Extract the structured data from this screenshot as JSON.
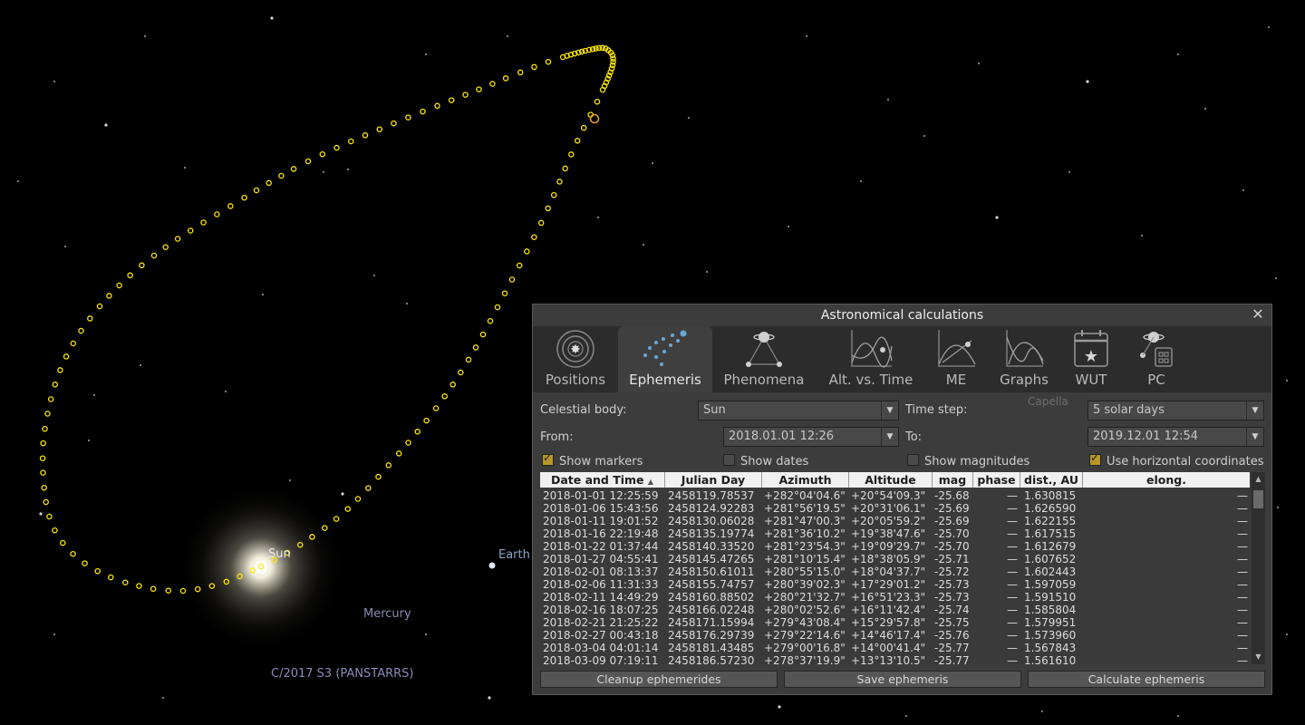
{
  "sky_labels": {
    "sun": "Sun",
    "earth": "Earth",
    "mercury": "Mercury",
    "comet": "C/2017 S3 (PANSTARRS)"
  },
  "colors": {
    "trajectory": "#ffe800",
    "dialog_bg": "#3c3c3c",
    "accent_check": "#b8962a"
  },
  "dialog": {
    "title": "Astronomical calculations",
    "close_icon": "close-icon",
    "tabs": [
      {
        "label": "Positions",
        "icon": "positions-icon"
      },
      {
        "label": "Ephemeris",
        "icon": "ephemeris-icon",
        "active": true
      },
      {
        "label": "Phenomena",
        "icon": "phenomena-icon"
      },
      {
        "label": "Alt. vs. Time",
        "icon": "alt-vs-time-icon"
      },
      {
        "label": "ME",
        "icon": "monthly-elevation-icon"
      },
      {
        "label": "Graphs",
        "icon": "graphs-icon"
      },
      {
        "label": "WUT",
        "icon": "calendar-star-icon"
      },
      {
        "label": "PC",
        "icon": "planetary-calculator-icon"
      }
    ],
    "form": {
      "celestial_body_label": "Celestial body:",
      "celestial_body_value": "Sun",
      "time_step_label": "Time step:",
      "time_step_value": "5 solar days",
      "from_label": "From:",
      "from_value": "2018.01.01 12:26",
      "to_label": "To:",
      "to_value": "2019.12.01 12:54",
      "bg_star_label": "Capella"
    },
    "checks": {
      "show_markers": {
        "label": "Show markers",
        "checked": true
      },
      "show_dates": {
        "label": "Show dates",
        "checked": false
      },
      "show_magnitudes": {
        "label": "Show magnitudes",
        "checked": false
      },
      "use_horizontal": {
        "label": "Use horizontal coordinates",
        "checked": true
      }
    },
    "table": {
      "columns": [
        "Date and Time",
        "Julian Day",
        "Azimuth",
        "Altitude",
        "mag",
        "phase",
        "dist., AU",
        "elong."
      ],
      "sort_indicator": "▲",
      "rows": [
        [
          "2018-01-01 12:25:59",
          "2458119.78537",
          "+282°04'04.6\"",
          "+20°54'09.3\"",
          "-25.68",
          "—",
          "1.630815",
          "—"
        ],
        [
          "2018-01-06 15:43:56",
          "2458124.92283",
          "+281°56'19.5\"",
          "+20°31'06.1\"",
          "-25.69",
          "—",
          "1.626590",
          "—"
        ],
        [
          "2018-01-11 19:01:52",
          "2458130.06028",
          "+281°47'00.3\"",
          "+20°05'59.2\"",
          "-25.69",
          "—",
          "1.622155",
          "—"
        ],
        [
          "2018-01-16 22:19:48",
          "2458135.19774",
          "+281°36'10.2\"",
          "+19°38'47.6\"",
          "-25.70",
          "—",
          "1.617515",
          "—"
        ],
        [
          "2018-01-22 01:37:44",
          "2458140.33520",
          "+281°23'54.3\"",
          "+19°09'29.7\"",
          "-25.70",
          "—",
          "1.612679",
          "—"
        ],
        [
          "2018-01-27 04:55:41",
          "2458145.47265",
          "+281°10'15.4\"",
          "+18°38'05.9\"",
          "-25.71",
          "—",
          "1.607652",
          "—"
        ],
        [
          "2018-02-01 08:13:37",
          "2458150.61011",
          "+280°55'15.0\"",
          "+18°04'37.7\"",
          "-25.72",
          "—",
          "1.602443",
          "—"
        ],
        [
          "2018-02-06 11:31:33",
          "2458155.74757",
          "+280°39'02.3\"",
          "+17°29'01.2\"",
          "-25.73",
          "—",
          "1.597059",
          "—"
        ],
        [
          "2018-02-11 14:49:29",
          "2458160.88502",
          "+280°21'32.7\"",
          "+16°51'23.3\"",
          "-25.73",
          "—",
          "1.591510",
          "—"
        ],
        [
          "2018-02-16 18:07:25",
          "2458166.02248",
          "+280°02'52.6\"",
          "+16°11'42.4\"",
          "-25.74",
          "—",
          "1.585804",
          "—"
        ],
        [
          "2018-02-21 21:25:22",
          "2458171.15994",
          "+279°43'08.4\"",
          "+15°29'57.8\"",
          "-25.75",
          "—",
          "1.579951",
          "—"
        ],
        [
          "2018-02-27 00:43:18",
          "2458176.29739",
          "+279°22'14.6\"",
          "+14°46'17.4\"",
          "-25.76",
          "—",
          "1.573960",
          "—"
        ],
        [
          "2018-03-04 04:01:14",
          "2458181.43485",
          "+279°00'16.8\"",
          "+14°00'41.4\"",
          "-25.77",
          "—",
          "1.567843",
          "—"
        ],
        [
          "2018-03-09 07:19:11",
          "2458186.57230",
          "+278°37'19.9\"",
          "+13°13'10.5\"",
          "-25.77",
          "—",
          "1.561610",
          "—"
        ]
      ]
    },
    "buttons": {
      "cleanup": "Cleanup ephemerides",
      "save": "Save ephemeris",
      "calculate": "Calculate ephemeris"
    }
  }
}
